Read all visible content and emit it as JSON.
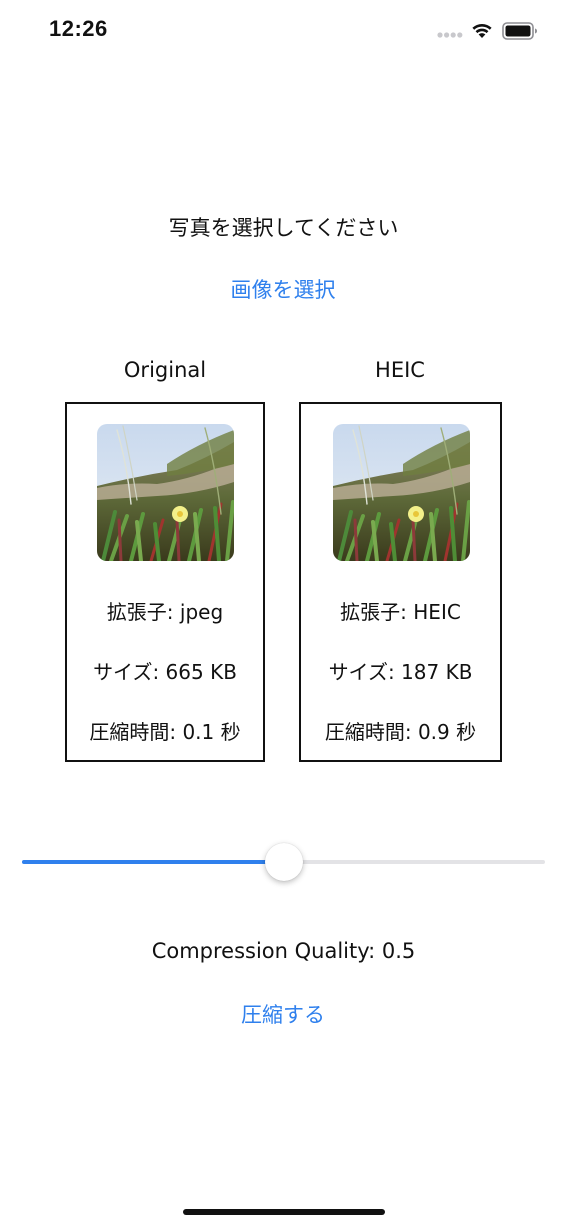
{
  "status_bar": {
    "time": "12:26"
  },
  "header": {
    "prompt": "写真を選択してください",
    "select_image_label": "画像を選択"
  },
  "columns": [
    {
      "title": "Original",
      "extension": "拡張子: jpeg",
      "size": "サイズ: 665 KB",
      "compression_time": "圧縮時間: 0.1 秒"
    },
    {
      "title": "HEIC",
      "extension": "拡張子: HEIC",
      "size": "サイズ: 187 KB",
      "compression_time": "圧縮時間: 0.9 秒"
    }
  ],
  "slider": {
    "value": 0.5,
    "min": 0,
    "max": 1
  },
  "quality_label": "Compression Quality: 0.5",
  "compress_label": "圧縮する",
  "colors": {
    "accent": "#2f80ed",
    "track": "#e3e3e6",
    "text": "#111111"
  },
  "icons": [
    "signal-dots-icon",
    "wifi-icon",
    "battery-icon"
  ]
}
